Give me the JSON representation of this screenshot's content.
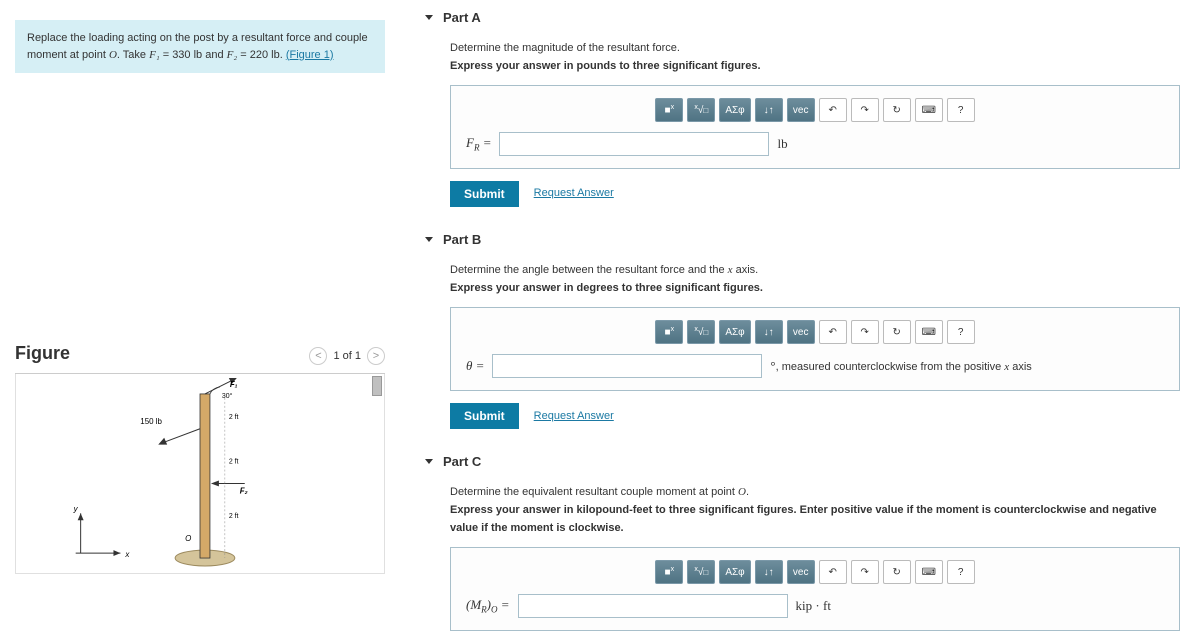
{
  "problem": {
    "text_prefix": "Replace the loading acting on the post by a resultant force and couple moment at point ",
    "point": "O",
    "text_mid": ". Take ",
    "f1_label": "F₁",
    "f1_eq": " = 330 lb and ",
    "f2_label": "F₂",
    "f2_eq": " = 220 lb. ",
    "figure_link": "(Figure 1)"
  },
  "figure": {
    "title": "Figure",
    "nav_text": "1 of 1",
    "prev": "<",
    "next": ">",
    "labels": {
      "F1": "F₁",
      "F2": "F₂",
      "load": "150 lb",
      "angle": "30°",
      "d1": "2 ft",
      "d2": "2 ft",
      "d3": "2 ft",
      "y": "y",
      "x": "x",
      "O": "O"
    }
  },
  "parts": [
    {
      "title": "Part A",
      "line1": "Determine the magnitude of the resultant force.",
      "line2": "Express your answer in pounds to three significant figures.",
      "var": "F_R =",
      "var_html": "F<sub style='font-style:italic;font-size:9px'>R</sub> =",
      "unit": "lb",
      "post_unit": ""
    },
    {
      "title": "Part B",
      "line1": "Determine the angle between the resultant force and the x axis.",
      "line1_html": "Determine the angle between the resultant force and the <span class='math'>x</span> axis.",
      "var": "θ =",
      "unit": "°",
      "post_unit": ", measured counterclockwise from the positive x axis",
      "post_unit_html": ", measured counterclockwise from the positive <span class='math'>x</span> axis",
      "line2": "Express your answer in degrees to three significant figures."
    },
    {
      "title": "Part C",
      "line1": "Determine the equivalent resultant couple moment at point O.",
      "line1_html": "Determine the equivalent resultant couple moment at point <span class='math'>O</span>.",
      "line2": "Express your answer in kilopound-feet to three significant figures. Enter positive value if the moment is counterclockwise and negative value if the moment is clockwise.",
      "var": "(M_R)_O =",
      "var_html": "(M<sub style='font-style:italic;font-size:9px'>R</sub>)<sub style='font-style:italic;font-size:9px'>O</sub> =",
      "unit": "kip · ft",
      "post_unit": ""
    }
  ],
  "toolbar": {
    "templates": "■",
    "root": "√",
    "greek": "ΑΣφ",
    "arrows": "↓↑",
    "vec": "vec",
    "undo": "↶",
    "redo": "↷",
    "reset": "↻",
    "keyboard": "⌨",
    "help": "?"
  },
  "buttons": {
    "submit": "Submit",
    "request": "Request Answer"
  }
}
